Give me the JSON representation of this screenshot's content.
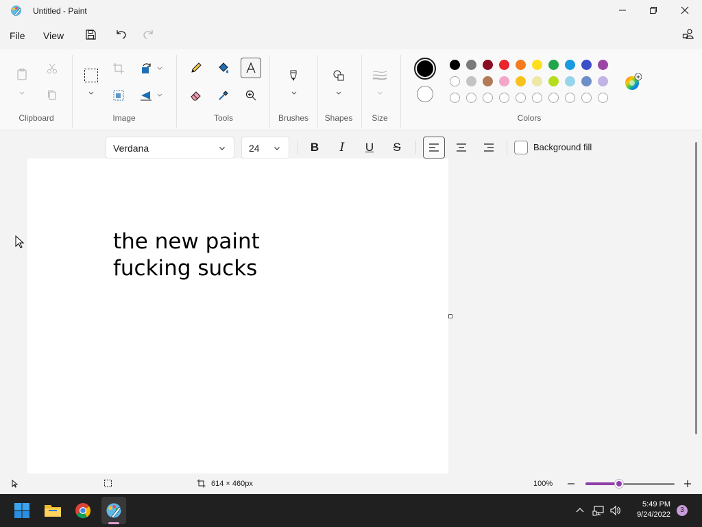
{
  "window": {
    "title": "Untitled - Paint"
  },
  "menu": {
    "file": "File",
    "view": "View"
  },
  "ribbon": {
    "groups": {
      "clipboard": "Clipboard",
      "image": "Image",
      "tools": "Tools",
      "brushes": "Brushes",
      "shapes": "Shapes",
      "size": "Size",
      "colors": "Colors"
    },
    "accent": "#8e3fa8"
  },
  "colors": {
    "primary": "#000000",
    "secondary": "#ffffff",
    "palette_row1": [
      "#000000",
      "#7a7a7a",
      "#8b0f22",
      "#e8262b",
      "#f47b20",
      "#fde01a",
      "#23a64b",
      "#1a9ae0",
      "#3c4ec8",
      "#9b45a6"
    ],
    "palette_row2": [
      "#ffffff",
      "#c3c3c3",
      "#b27a57",
      "#f4a6c8",
      "#f8c21c",
      "#ede8a6",
      "#b5dd1e",
      "#98d4ea",
      "#6c8fc8",
      "#c2b4e2"
    ]
  },
  "text_toolbar": {
    "font": "Verdana",
    "size": "24",
    "bold": "B",
    "italic": "I",
    "underline": "U",
    "strikethrough": "S",
    "background_fill": "Background fill"
  },
  "canvas": {
    "text": "the new paint\nfucking sucks"
  },
  "status": {
    "dimensions": "614 × 460px",
    "zoom": "100%",
    "zoom_value": 100
  },
  "taskbar": {
    "time": "5:49 PM",
    "date": "9/24/2022",
    "notifications": "3"
  }
}
